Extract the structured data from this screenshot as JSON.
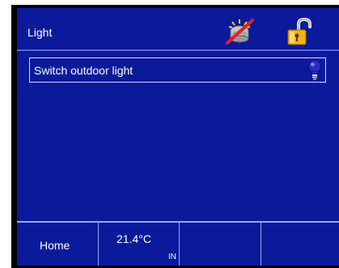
{
  "header": {
    "title": "Light",
    "icons": [
      "alarm-off-icon",
      "unlocked-padlock-icon"
    ]
  },
  "main": {
    "items": [
      {
        "label": "Switch outdoor light",
        "icon": "light-bulb-icon"
      }
    ]
  },
  "footer": {
    "home_label": "Home",
    "temperature": "21.4°C",
    "temperature_source": "IN"
  },
  "colors": {
    "background": "#0a1a9a",
    "border": "#9aa5ff",
    "text": "#ffffff"
  }
}
